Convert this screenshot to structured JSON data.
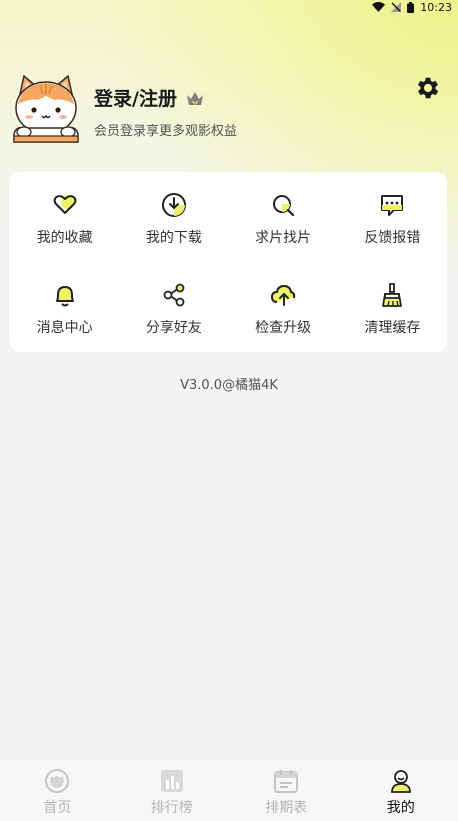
{
  "status_bar": {
    "time": "10:23"
  },
  "profile": {
    "title": "登录/注册",
    "subtitle": "会员登录享更多观影权益"
  },
  "menu": {
    "items": [
      {
        "label": "我的收藏",
        "icon": "heart-icon"
      },
      {
        "label": "我的下载",
        "icon": "download-icon"
      },
      {
        "label": "求片找片",
        "icon": "search-film-icon"
      },
      {
        "label": "反馈报错",
        "icon": "feedback-icon"
      },
      {
        "label": "消息中心",
        "icon": "bell-icon"
      },
      {
        "label": "分享好友",
        "icon": "share-icon"
      },
      {
        "label": "检查升级",
        "icon": "upload-cloud-icon"
      },
      {
        "label": "清理缓存",
        "icon": "broom-icon"
      }
    ]
  },
  "version": "V3.0.0@橘猫4K",
  "nav": {
    "items": [
      {
        "label": "首页",
        "icon": "home-icon",
        "active": false
      },
      {
        "label": "排行榜",
        "icon": "ranking-icon",
        "active": false
      },
      {
        "label": "排期表",
        "icon": "calendar-icon",
        "active": false
      },
      {
        "label": "我的",
        "icon": "profile-icon",
        "active": true
      }
    ]
  },
  "colors": {
    "accent": "#eef36a",
    "header_gradient": "#f2f7b6",
    "background": "#f4f4f4",
    "active_text": "#111111",
    "inactive_text": "#b5b5b5"
  }
}
